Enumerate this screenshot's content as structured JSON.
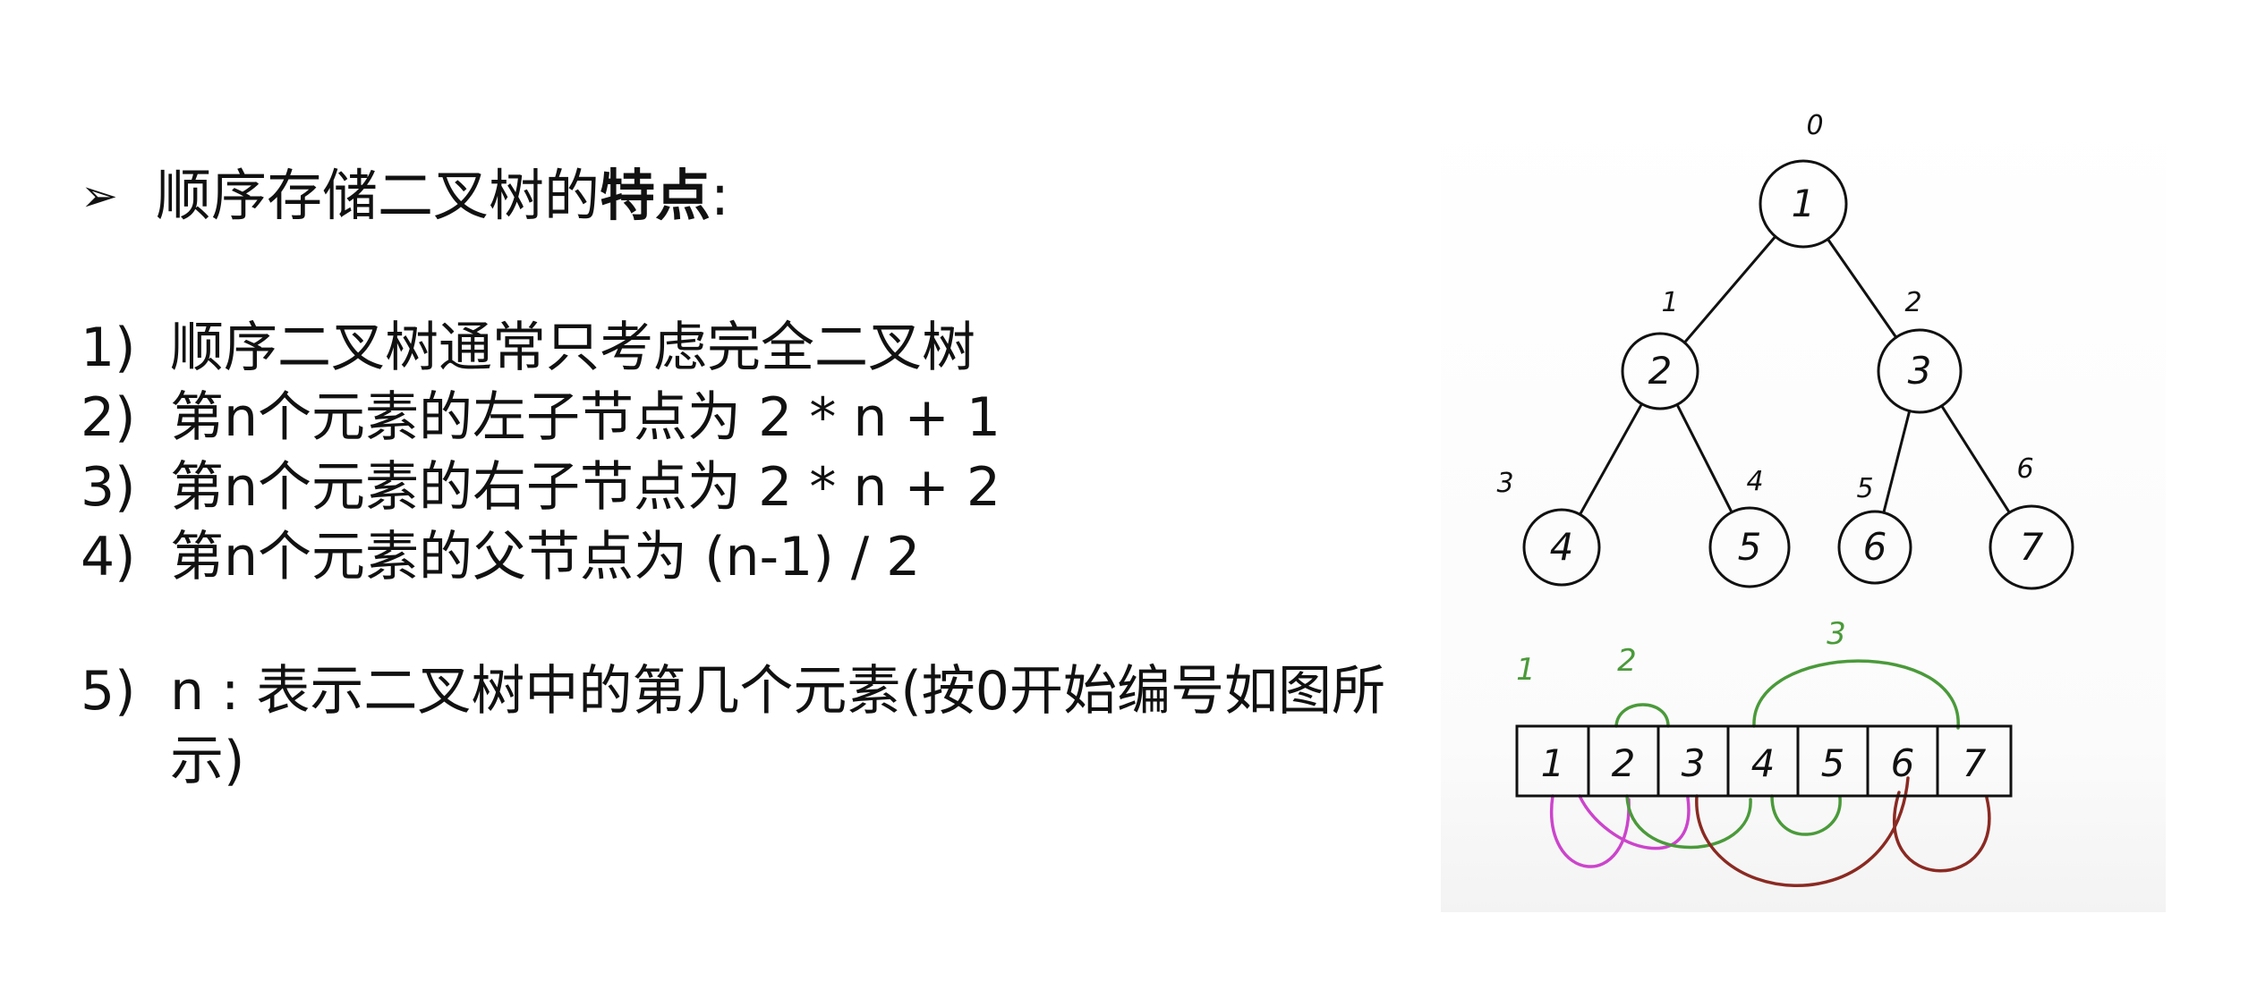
{
  "heading": {
    "arrow": "➢",
    "text_normal": "顺序存储二叉树的",
    "text_bold": "特点",
    "suffix": ":"
  },
  "points": [
    {
      "num": "1)",
      "text": "顺序二叉树通常只考虑完全二叉树"
    },
    {
      "num": "2)",
      "text": "第n个元素的左子节点为  2 * n + 1"
    },
    {
      "num": "3)",
      "text": "第n个元素的右子节点为  2 * n + 2"
    },
    {
      "num": "4)",
      "text": "第n个元素的父节点为  (n-1) / 2"
    },
    {
      "num": "5)",
      "text": "n : 表示二叉树中的第几个元素(按0开始编号如图所示)"
    }
  ],
  "diagram": {
    "nodes": [
      "1",
      "2",
      "3",
      "4",
      "5",
      "6",
      "7"
    ],
    "indices": [
      "0",
      "1",
      "2",
      "3",
      "4",
      "5",
      "6"
    ],
    "array": [
      "1",
      "2",
      "3",
      "4",
      "5",
      "6",
      "7"
    ],
    "arc_labels": [
      "1",
      "2",
      "3"
    ],
    "colors": {
      "ink": "#111111",
      "magenta": "#cc44cc",
      "green": "#4a9a3a",
      "darkred": "#8a2a22"
    }
  }
}
